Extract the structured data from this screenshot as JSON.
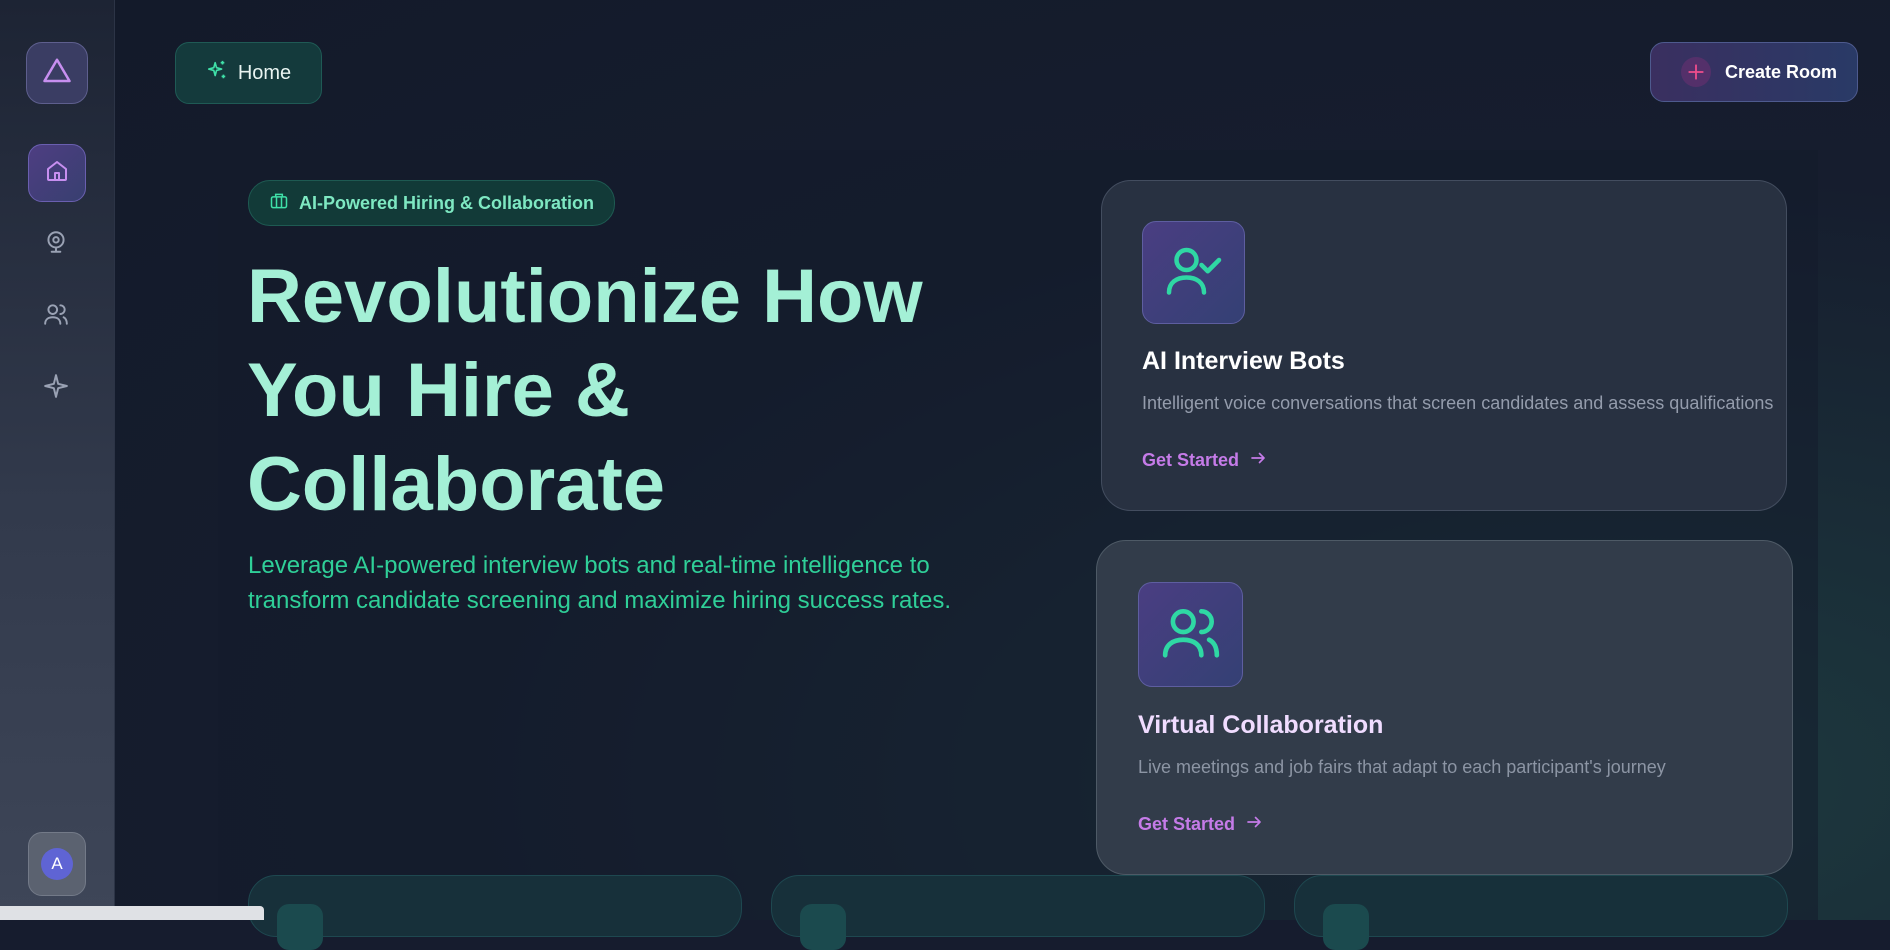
{
  "top_nav": {
    "home_label": "Home",
    "create_room_label": "Create Room"
  },
  "sidebar": {
    "items": [
      {
        "name": "home",
        "icon": "home-icon",
        "active": true
      },
      {
        "name": "webcam",
        "icon": "webcam-icon",
        "active": false
      },
      {
        "name": "users",
        "icon": "users-icon",
        "active": false
      },
      {
        "name": "sparkle",
        "icon": "sparkle-icon",
        "active": false
      }
    ],
    "avatar_initial": "A"
  },
  "hero": {
    "badge": "AI-Powered Hiring & Collaboration",
    "headline_line1": "Revolutionize How",
    "headline_line2": "You Hire &",
    "headline_line3": "Collaborate",
    "subtext": "Leverage AI-powered interview bots and real-time intelligence to transform candidate screening and maximize hiring success rates."
  },
  "features": [
    {
      "title": "AI Interview Bots",
      "description": "Intelligent voice conversations that screen candidates and assess qualifications",
      "link": "Get Started",
      "icon": "user-check-icon"
    },
    {
      "title": "Virtual Collaboration",
      "description": "Live meetings and job fairs that adapt to each participant's journey",
      "link": "Get Started",
      "icon": "users-icon"
    }
  ],
  "colors": {
    "accent_green": "#2fcf98",
    "headline": "#a4f0d6",
    "link_purple": "#c57be8"
  }
}
